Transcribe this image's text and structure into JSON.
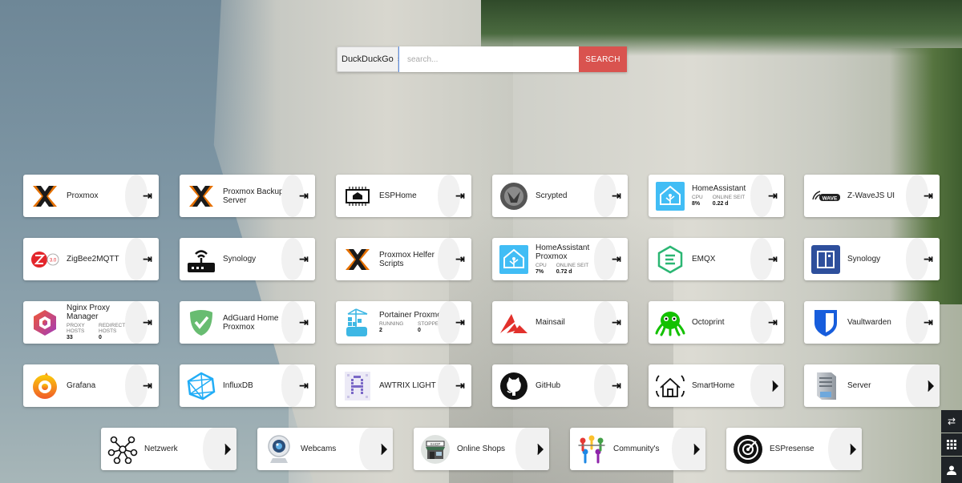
{
  "search": {
    "engine": "DuckDuckGo",
    "placeholder": "search...",
    "button": "SEARCH"
  },
  "tiles_row1": [
    {
      "name": "Proxmox",
      "icon": "proxmox-icon",
      "action": "open-icon"
    },
    {
      "name": "Proxmox Backup Server",
      "icon": "proxmox-icon",
      "action": "open-icon"
    },
    {
      "name": "ESPHome",
      "icon": "esphome-icon",
      "action": "open-icon"
    },
    {
      "name": "Scrypted",
      "icon": "scrypted-icon",
      "action": "open-icon"
    },
    {
      "name": "HomeAssistant",
      "icon": "homeassistant-icon",
      "action": "open-icon",
      "stats": [
        {
          "label": "CPU",
          "value": "8%"
        },
        {
          "label": "ONLINE SEIT",
          "value": "0.22 d"
        }
      ]
    },
    {
      "name": "Z-WaveJS UI",
      "icon": "zwave-icon",
      "action": "open-icon"
    }
  ],
  "tiles_row2": [
    {
      "name": "ZigBee2MQTT",
      "icon": "zigbee-icon",
      "action": "open-icon"
    },
    {
      "name": "Synology",
      "icon": "router-icon",
      "action": "open-icon"
    },
    {
      "name": "Proxmox Helfer Scripts",
      "icon": "proxmox-icon",
      "action": "open-icon"
    },
    {
      "name": "HomeAssistant Proxmox",
      "icon": "homeassistant-icon",
      "action": "open-icon",
      "stats": [
        {
          "label": "CPU",
          "value": "7%"
        },
        {
          "label": "ONLINE SEIT",
          "value": "0.72 d"
        }
      ]
    },
    {
      "name": "EMQX",
      "icon": "emqx-icon",
      "action": "open-icon"
    },
    {
      "name": "Synology",
      "icon": "synology-icon",
      "action": "open-icon"
    }
  ],
  "tiles_row3": [
    {
      "name": "Nginx Proxy Manager",
      "icon": "nginx-proxy-icon",
      "action": "open-icon",
      "stats": [
        {
          "label": "PROXY HOSTS",
          "value": "33"
        },
        {
          "label": "REDIRECTION HOSTS",
          "value": "0"
        }
      ]
    },
    {
      "name": "AdGuard Home Proxmox",
      "icon": "adguard-icon",
      "action": "open-icon"
    },
    {
      "name": "Portainer Proxmox",
      "icon": "portainer-icon",
      "action": "open-icon",
      "stats": [
        {
          "label": "RUNNING",
          "value": "2"
        },
        {
          "label": "STOPPED",
          "value": "0"
        }
      ]
    },
    {
      "name": "Mainsail",
      "icon": "mainsail-icon",
      "action": "open-icon"
    },
    {
      "name": "Octoprint",
      "icon": "octoprint-icon",
      "action": "open-icon"
    },
    {
      "name": "Vaultwarden",
      "icon": "vaultwarden-icon",
      "action": "open-icon"
    }
  ],
  "tiles_row4": [
    {
      "name": "Grafana",
      "icon": "grafana-icon",
      "action": "open-icon"
    },
    {
      "name": "InfluxDB",
      "icon": "influxdb-icon",
      "action": "open-icon"
    },
    {
      "name": "AWTRIX LIGHT",
      "icon": "awtrix-icon",
      "action": "open-icon"
    },
    {
      "name": "GitHub",
      "icon": "github-icon",
      "action": "open-icon"
    },
    {
      "name": "SmartHome",
      "icon": "smarthome-icon",
      "action": "tag-icon"
    },
    {
      "name": "Server",
      "icon": "server-icon",
      "action": "tag-icon"
    }
  ],
  "tiles_row5": [
    {
      "name": "Netzwerk",
      "icon": "network-icon",
      "action": "tag-icon"
    },
    {
      "name": "Webcams",
      "icon": "webcam-icon",
      "action": "tag-icon"
    },
    {
      "name": "Online Shops",
      "icon": "shop-icon",
      "action": "tag-icon"
    },
    {
      "name": "Community's",
      "icon": "community-icon",
      "action": "tag-icon"
    },
    {
      "name": "ESPresense",
      "icon": "espresense-icon",
      "action": "tag-icon"
    }
  ],
  "side_controls": [
    "switch-icon",
    "grid-icon",
    "user-icon"
  ],
  "colors": {
    "search_button": "#d9534f",
    "tile_bg": "#ffffff",
    "side_bg": "#1f2327"
  }
}
